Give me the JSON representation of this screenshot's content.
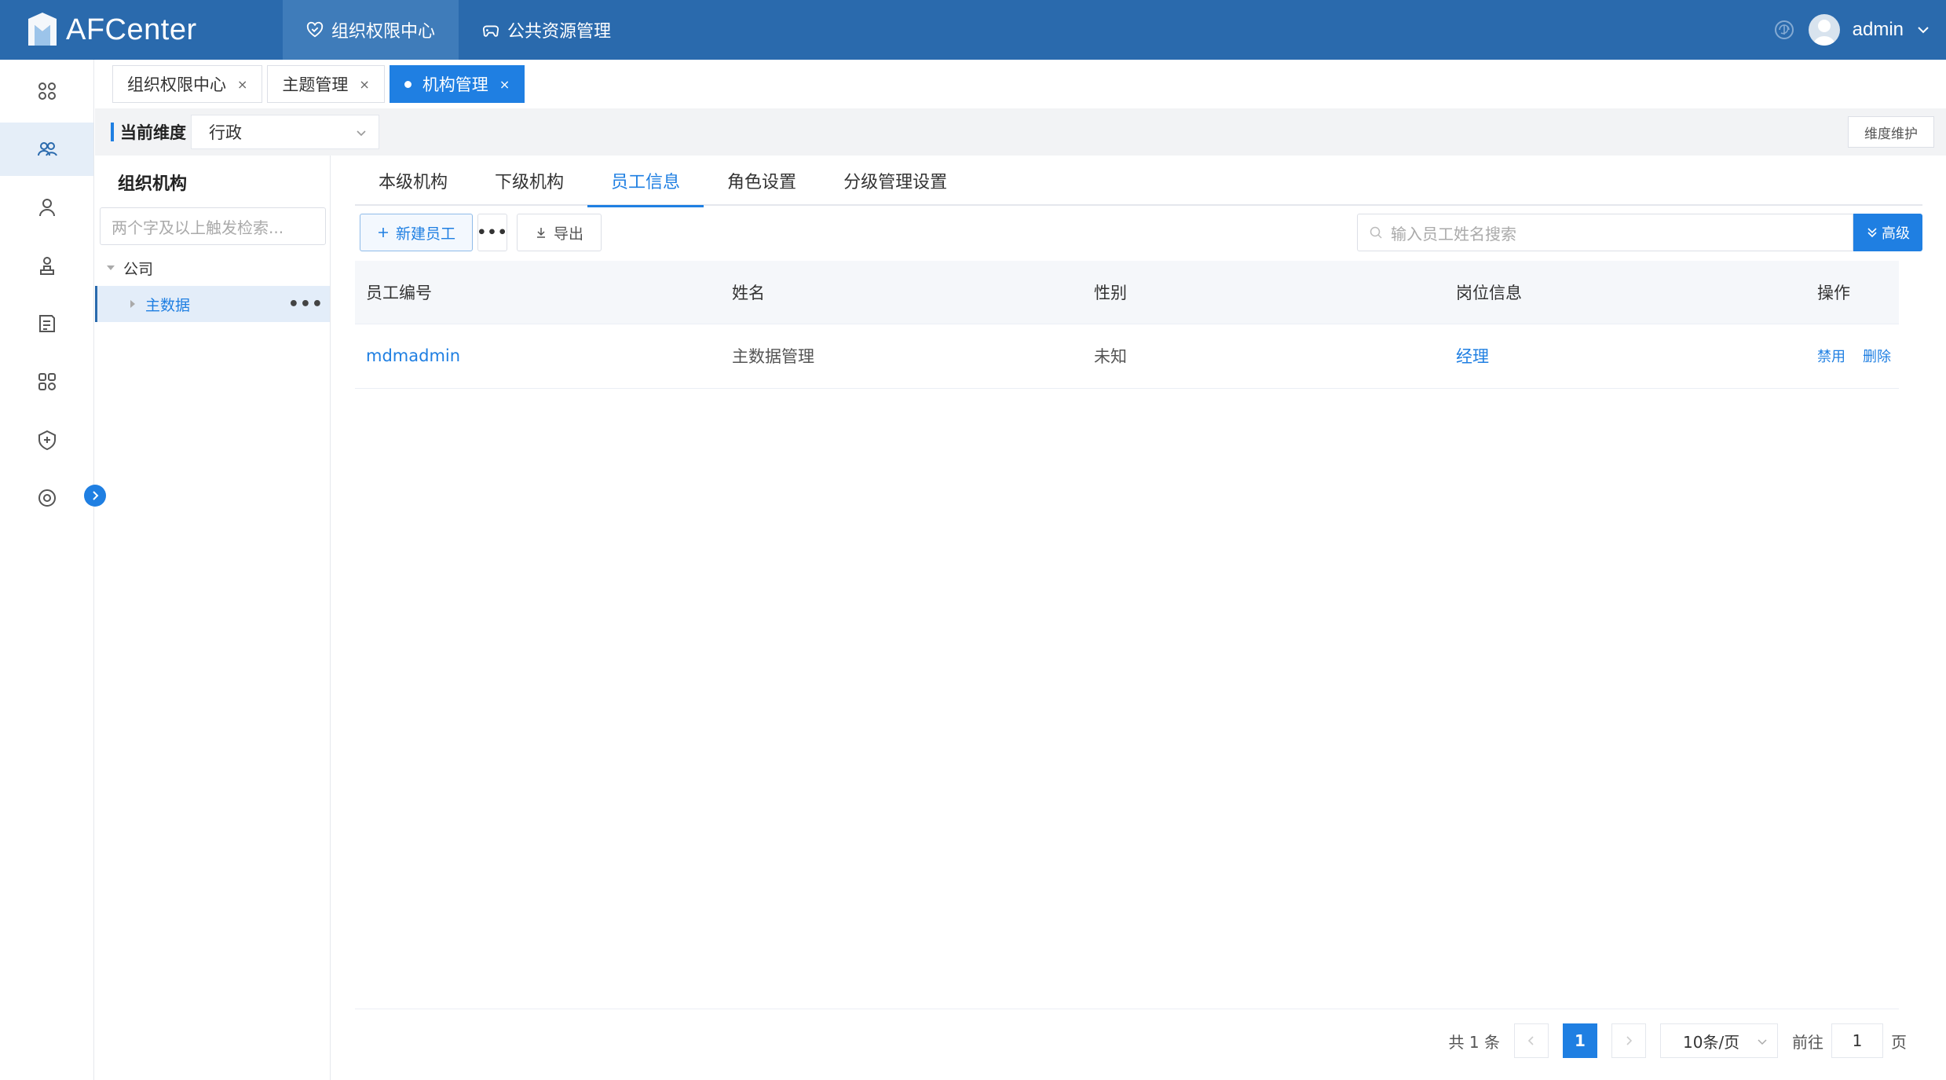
{
  "app": {
    "logo_text": "AFCenter"
  },
  "topnav": [
    {
      "label": "组织权限中心",
      "active": true
    },
    {
      "label": "公共资源管理",
      "active": false
    }
  ],
  "user": {
    "name": "admin"
  },
  "sidebar_icons": [
    "apps-icon",
    "team-icon",
    "user-icon",
    "role-icon",
    "form-icon",
    "grid-icon",
    "shield-icon",
    "settings-icon"
  ],
  "page_tabs": [
    {
      "label": "组织权限中心",
      "close": "×"
    },
    {
      "label": "主题管理",
      "close": "×"
    },
    {
      "label": "机构管理",
      "close": "×",
      "active": true
    }
  ],
  "dimension": {
    "label": "当前维度",
    "value": "行政",
    "maint_button": "维度维护"
  },
  "org": {
    "title": "组织机构",
    "search_placeholder": "两个字及以上触发检索...",
    "tree": [
      {
        "label": "公司",
        "level": 0,
        "expanded": true
      },
      {
        "label": "主数据",
        "level": 1,
        "selected": true,
        "more": "•••"
      }
    ]
  },
  "sub_tabs": [
    {
      "label": "本级机构"
    },
    {
      "label": "下级机构"
    },
    {
      "label": "员工信息",
      "active": true
    },
    {
      "label": "角色设置"
    },
    {
      "label": "分级管理设置"
    }
  ],
  "toolbar": {
    "new_button": "新建员工",
    "more_button": "•••",
    "export_button": "导出",
    "search_placeholder": "输入员工姓名搜索",
    "advanced_button": "高级"
  },
  "table": {
    "columns": [
      "员工编号",
      "姓名",
      "性别",
      "岗位信息",
      "操作"
    ],
    "rows": [
      {
        "code": "mdmadmin",
        "name": "主数据管理",
        "gender": "未知",
        "position": "经理",
        "op_disable": "禁用",
        "op_delete": "删除"
      }
    ]
  },
  "pagination": {
    "total_text": "共 1 条",
    "current_page": "1",
    "page_size": "10条/页",
    "goto_label": "前往",
    "goto_value": "1",
    "page_unit": "页"
  },
  "colors": {
    "topbar": "#2a6aad",
    "accent": "#1f7fe2"
  }
}
